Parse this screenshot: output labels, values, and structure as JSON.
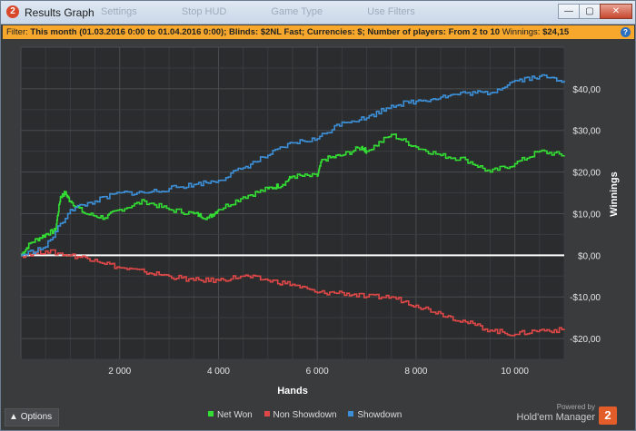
{
  "window": {
    "title": "Results Graph",
    "toolbar_ghost": [
      "Settings",
      "Stop HUD",
      "Game Type",
      "Use Filters"
    ]
  },
  "filter": {
    "label": "Filter:",
    "text": "This month (01.03.2016 0:00 to 01.04.2016 0:00); Blinds: $2NL Fast; Currencies: $; Number of players: From 2 to 10",
    "winnings_label": "Winnings:",
    "winnings_value": "$24,15"
  },
  "options_label": "Options",
  "brand": {
    "powered": "Powered by",
    "name": "Hold'em Manager",
    "logo": "2"
  },
  "colors": {
    "net_won": "#33dd33",
    "non_showdown": "#e04848",
    "showdown": "#3c8fd6",
    "filter_bar": "#f7a82c"
  },
  "chart_data": {
    "type": "line",
    "xlabel": "Hands",
    "ylabel": "Winnings",
    "xlim": [
      0,
      11000
    ],
    "ylim": [
      -25,
      50
    ],
    "x_ticks": [
      2000,
      4000,
      6000,
      8000,
      10000
    ],
    "x_tick_labels": [
      "2 000",
      "4 000",
      "6 000",
      "8 000",
      "10 000"
    ],
    "y_ticks": [
      40,
      30,
      20,
      10,
      0,
      -10,
      -20
    ],
    "y_tick_labels": [
      "$40,00",
      "$30,00",
      "$20,00",
      "$10,00",
      "$0,00",
      "-$10,00",
      "-$20,00"
    ],
    "legend": [
      "Net Won",
      "Non Showdown",
      "Showdown"
    ],
    "series": [
      {
        "name": "Net Won",
        "color": "#33dd33",
        "x": [
          0,
          200,
          500,
          700,
          800,
          900,
          1000,
          1300,
          1700,
          2000,
          2500,
          3000,
          3500,
          3800,
          4000,
          4500,
          5000,
          5300,
          5500,
          6000,
          6100,
          6500,
          6900,
          7000,
          7500,
          8000,
          8500,
          9000,
          9500,
          10000,
          10500,
          11000
        ],
        "y": [
          0,
          3,
          5,
          6,
          14,
          15,
          13,
          10,
          9,
          11,
          13,
          11,
          10,
          9,
          11,
          14,
          16,
          17,
          19,
          19,
          23,
          24,
          26,
          25,
          29,
          26,
          24,
          23,
          20,
          22,
          25,
          24
        ]
      },
      {
        "name": "Non Showdown",
        "color": "#e04848",
        "x": [
          0,
          500,
          1000,
          1500,
          2000,
          2500,
          3000,
          3500,
          4000,
          4500,
          5000,
          5500,
          6000,
          6500,
          7000,
          7500,
          8000,
          8500,
          9000,
          9500,
          10000,
          10500,
          11000
        ],
        "y": [
          0,
          1,
          0,
          -1,
          -3,
          -4,
          -5,
          -6,
          -6,
          -5,
          -6,
          -7,
          -9,
          -9,
          -10,
          -10,
          -12,
          -14,
          -16,
          -18,
          -19,
          -18,
          -18
        ]
      },
      {
        "name": "Showdown",
        "color": "#3c8fd6",
        "x": [
          0,
          500,
          1000,
          1500,
          2000,
          2500,
          3000,
          3500,
          4000,
          4500,
          5000,
          5500,
          6000,
          6500,
          7000,
          7500,
          8000,
          8500,
          9000,
          9500,
          10000,
          10500,
          11000
        ],
        "y": [
          0,
          2,
          11,
          13,
          15,
          15,
          16,
          17,
          18,
          21,
          24,
          27,
          28,
          32,
          33,
          36,
          37,
          38,
          39,
          39,
          42,
          43,
          42
        ]
      }
    ]
  }
}
